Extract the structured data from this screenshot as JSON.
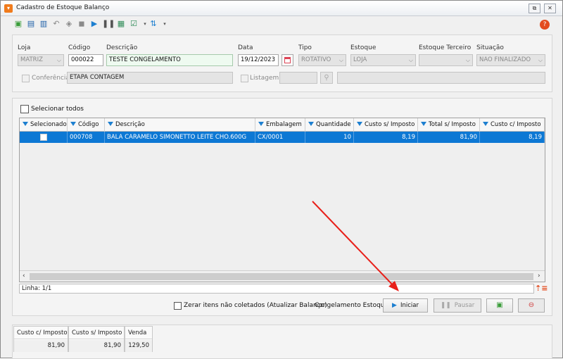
{
  "window": {
    "title": "Cadastro de Estoque Balanço",
    "restore_glyph": "⧉",
    "close_glyph": "✕"
  },
  "toolbar": {
    "icons": [
      "new-icon",
      "save-icon",
      "save-as-icon",
      "undo-icon",
      "print-icon",
      "edit-icon",
      "play-icon",
      "pause-icon",
      "calc-icon",
      "approve-icon",
      "refresh-icon"
    ]
  },
  "form": {
    "loja": {
      "label": "Loja",
      "value": "MATRIZ"
    },
    "codigo": {
      "label": "Código",
      "value": "000022"
    },
    "descricao": {
      "label": "Descrição",
      "value": "TESTE CONGELAMENTO"
    },
    "data": {
      "label": "Data",
      "value": "19/12/2023"
    },
    "tipo": {
      "label": "Tipo",
      "value": "ROTATIVO"
    },
    "estoque": {
      "label": "Estoque",
      "value": "LOJA"
    },
    "estoque_terceiro": {
      "label": "Estoque Terceiro",
      "value": ""
    },
    "situacao": {
      "label": "Situação",
      "value": "NAO FINALIZADO"
    },
    "conferencia": {
      "label": "Conferência",
      "value": "ETAPA CONTAGEM"
    },
    "listagem": {
      "label": "Listagem",
      "value": ""
    }
  },
  "select_all_label": "Selecionar todos",
  "grid": {
    "columns": [
      "Selecionado",
      "Código",
      "Descrição",
      "Embalagem",
      "Quantidade",
      "Custo s/ Imposto",
      "Total s/ Imposto",
      "Custo c/ Imposto"
    ],
    "rows": [
      {
        "codigo": "000708",
        "descricao": "BALA CARAMELO SIMONETTO LEITE CHO.600G",
        "embalagem": "CX/0001",
        "quantidade": "10",
        "custo_s": "8,19",
        "total_s": "81,90",
        "custo_c": "8,19"
      }
    ]
  },
  "status": {
    "linha": "Linha: 1/1"
  },
  "actions": {
    "zerar_label": "Zerar itens não coletados (Atualizar Balanço)",
    "congelamento_label": "Congelamento Estoque",
    "iniciar": "Iniciar",
    "pausar": "Pausar"
  },
  "summary": [
    {
      "label": "Custo c/ Imposto",
      "value": "81,90"
    },
    {
      "label": "Custo s/ Imposto",
      "value": "81,90"
    },
    {
      "label": "Venda",
      "value": "129,50"
    }
  ],
  "colors": {
    "accent": "#0d78d4",
    "brand": "#f07b1d",
    "annotation_arrow": "#e8201a"
  }
}
